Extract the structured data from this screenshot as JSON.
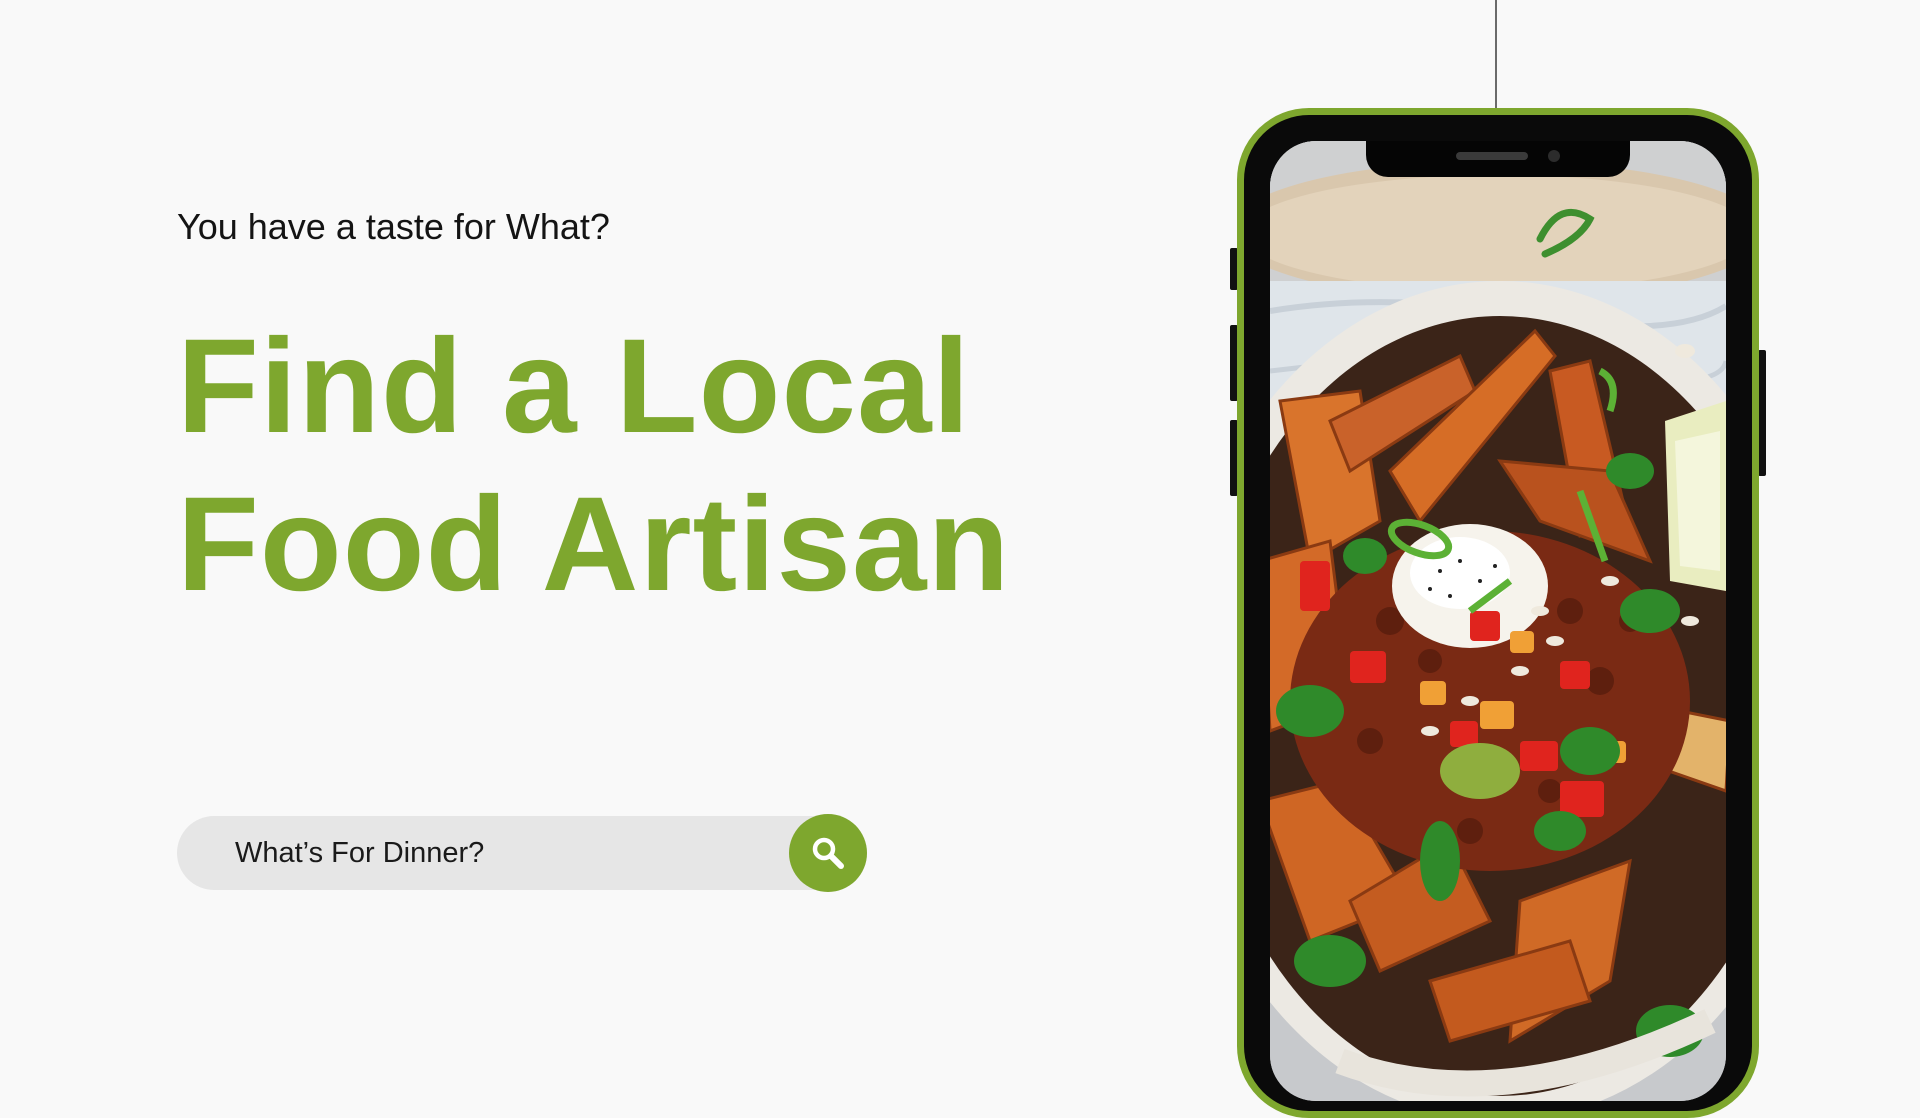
{
  "hero": {
    "tagline": "You have a taste for What?",
    "headline_line1": "Find a Local",
    "headline_line2": "Food Artisan"
  },
  "search": {
    "placeholder": "What’s For Dinner?",
    "value": "",
    "button_icon": "search-icon"
  },
  "phone": {
    "screen_image": "food-bowl-photo"
  },
  "colors": {
    "accent": "#7ea72e",
    "background": "#f9f9f9",
    "search_bg": "#e6e6e6",
    "text": "#141414"
  }
}
